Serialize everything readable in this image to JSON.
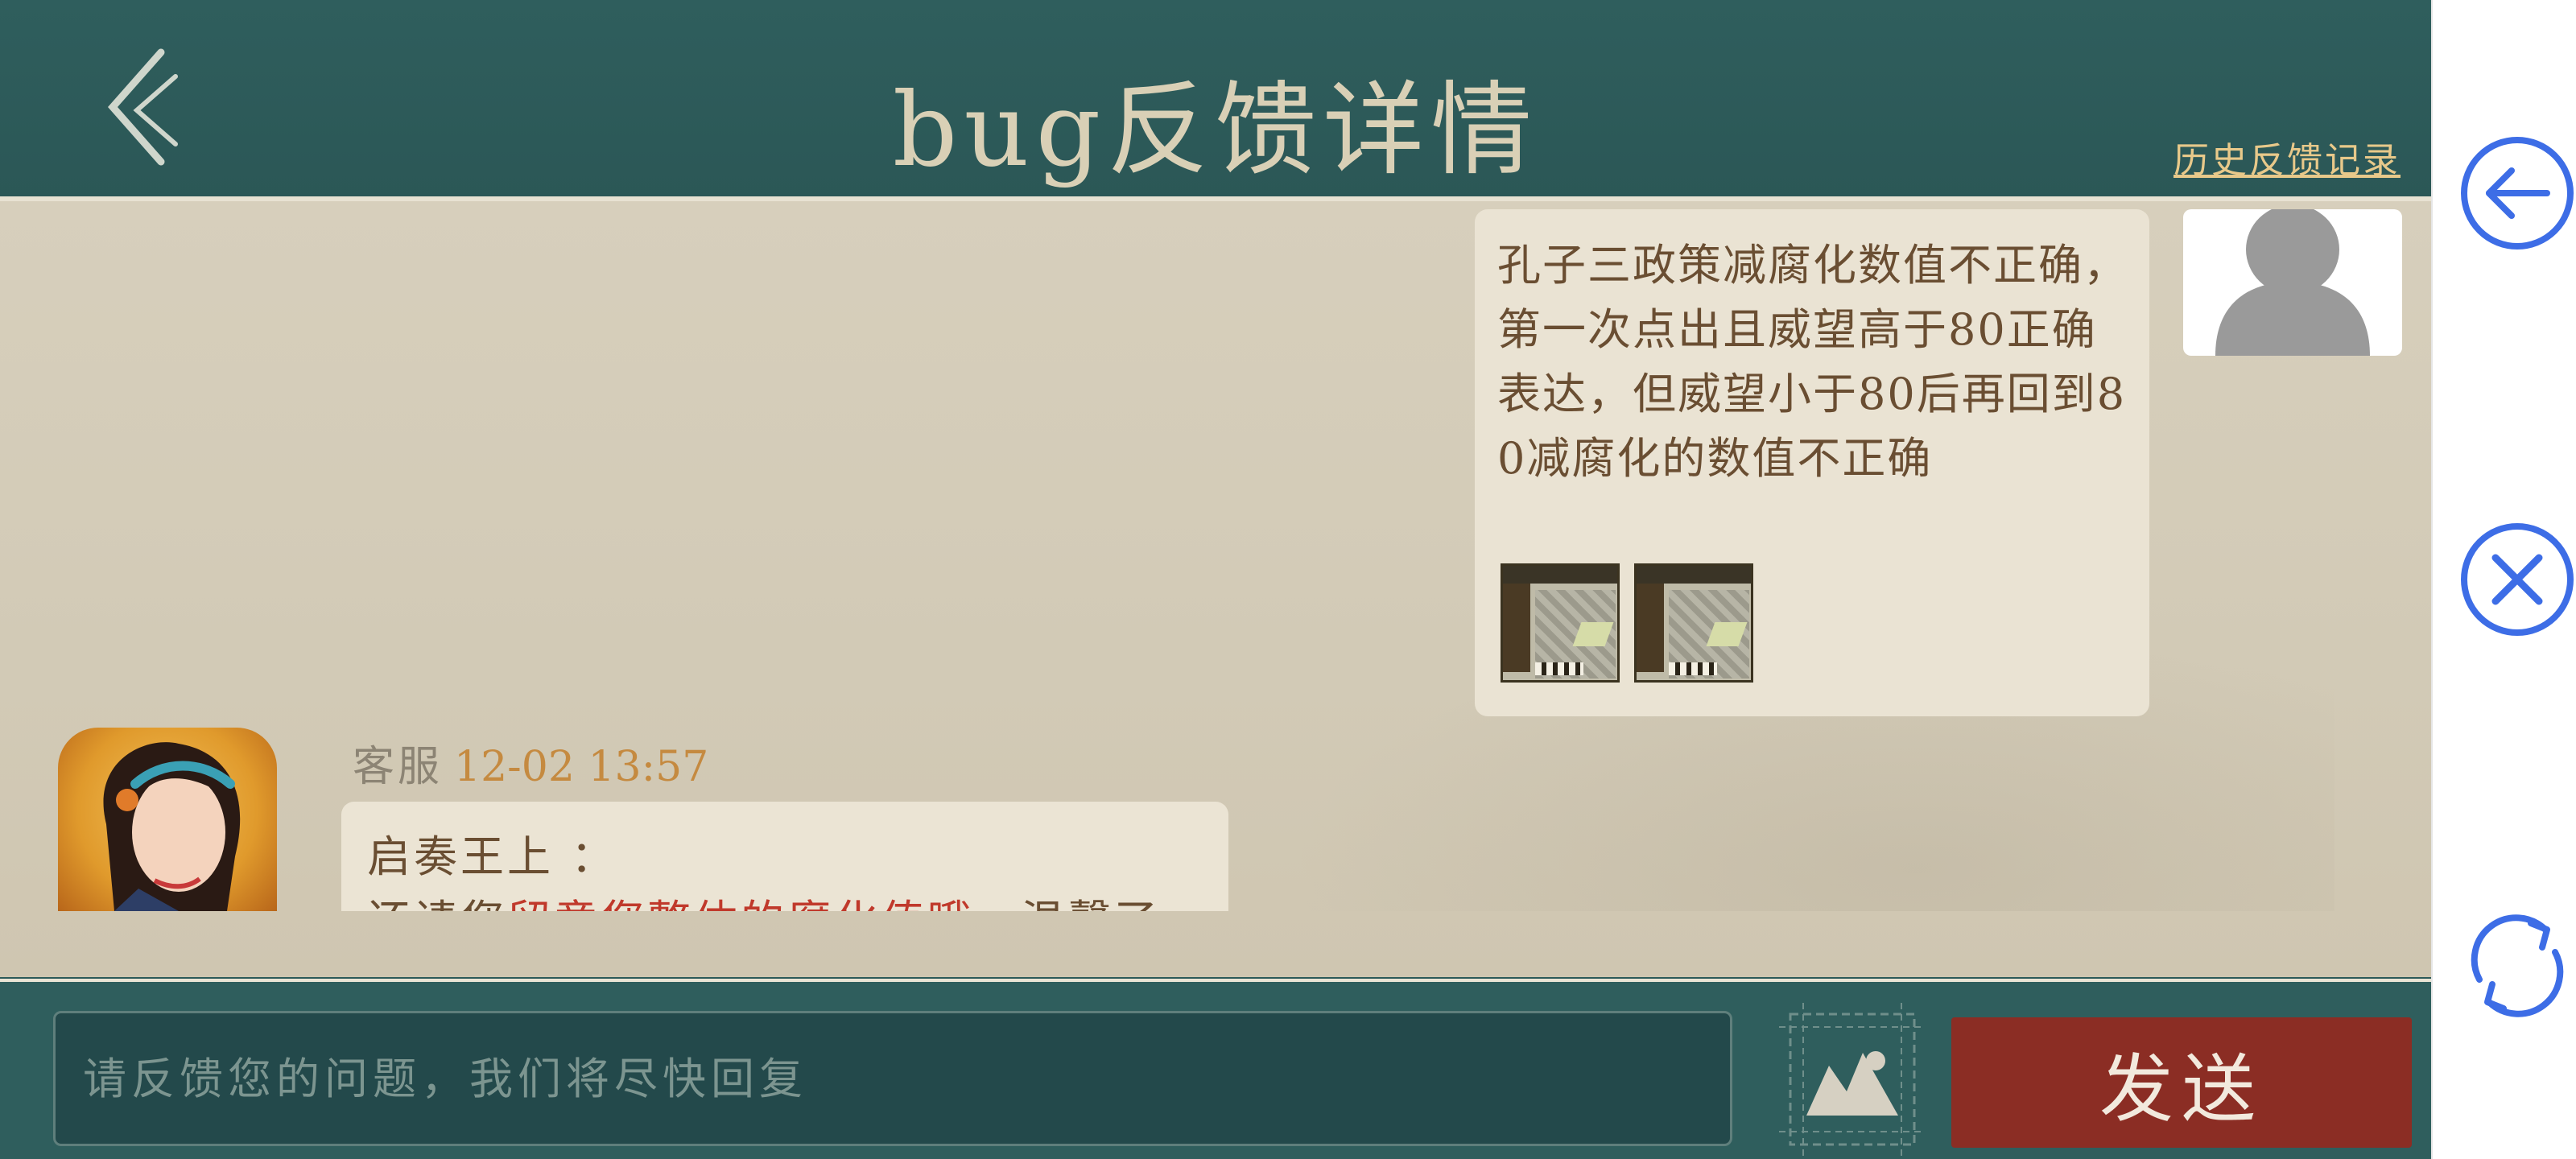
{
  "header": {
    "title": "bug反馈详情",
    "history_link": "历史反馈记录"
  },
  "messages": {
    "user": {
      "text": "孔子三政策减腐化数值不正确，第一次点出且威望高于80正确表达，但威望小于80后再回到80减腐化的数值不正确",
      "attachments": [
        "screenshot-1",
        "screenshot-2"
      ]
    },
    "service": {
      "role": "客服",
      "time": "12-02 13:57",
      "line1": "启奏王上 ：",
      "line2_plain_start": "还请您",
      "line2_red": "留意您整体的腐化值哦",
      "line2_plain_end": "，温馨了"
    }
  },
  "input": {
    "placeholder": "请反馈您的问题，我们将尽快回复",
    "value": ""
  },
  "buttons": {
    "send": "发送"
  },
  "colors": {
    "header_bg": "#2f5e5d",
    "chat_bg": "#d7cfbc",
    "send_bg": "#8b2d24",
    "side_icon": "#3d6de6"
  },
  "side_controls": {
    "icons": [
      "arrow-left-circle-icon",
      "close-circle-icon",
      "refresh-icon"
    ]
  }
}
